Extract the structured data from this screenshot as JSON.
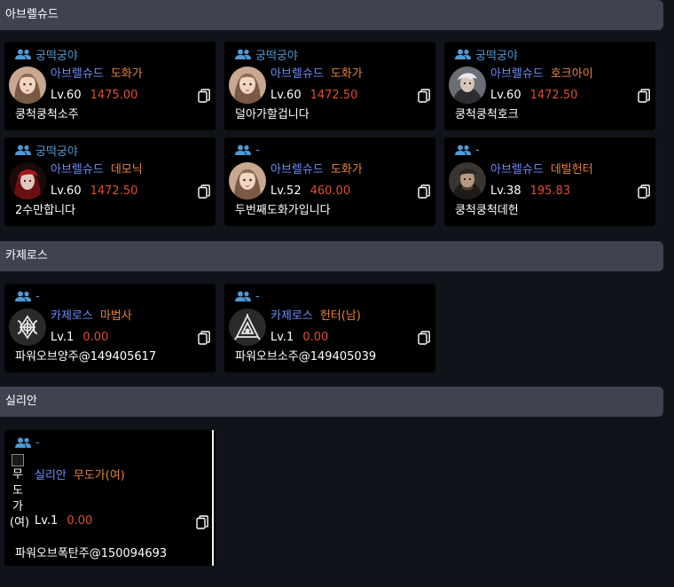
{
  "sections": [
    {
      "title": "아브렐슈드"
    },
    {
      "title": "카제로스"
    },
    {
      "title": "실리안"
    }
  ],
  "cards": [
    {
      "guild": "궁떡궁야",
      "server": "아브렐슈드",
      "class": "도화가",
      "level": "Lv.60",
      "item_level": "1475.00",
      "name": "쿵척쿵척소주",
      "avatar": "artist-female-avatar"
    },
    {
      "guild": "궁떡궁야",
      "server": "아브렐슈드",
      "class": "도화가",
      "level": "Lv.60",
      "item_level": "1472.50",
      "name": "덜아가할겁니다",
      "avatar": "artist-female-avatar"
    },
    {
      "guild": "궁떡궁야",
      "server": "아브렐슈드",
      "class": "호크아이",
      "level": "Lv.60",
      "item_level": "1472.50",
      "name": "쿵척쿵척호크",
      "avatar": "hawkeye-male-avatar"
    },
    {
      "guild": "궁떡궁야",
      "server": "아브렐슈드",
      "class": "데모닉",
      "level": "Lv.60",
      "item_level": "1472.50",
      "name": "2수만합니다",
      "avatar": "demonic-avatar"
    },
    {
      "guild": "-",
      "server": "아브렐슈드",
      "class": "도화가",
      "level": "Lv.52",
      "item_level": "460.00",
      "name": "두번째도화가입니다",
      "avatar": "artist-female-avatar"
    },
    {
      "guild": "-",
      "server": "아브렐슈드",
      "class": "데빌헌터",
      "level": "Lv.38",
      "item_level": "195.83",
      "name": "쿵척쿵척데헌",
      "avatar": "devil-hunter-avatar"
    },
    {
      "guild": "-",
      "server": "카제로스",
      "class": "마법사",
      "level": "Lv.1",
      "item_level": "0.00",
      "name": "파워오브양주@149405617",
      "avatar": "mage-emblem"
    },
    {
      "guild": "-",
      "server": "카제로스",
      "class": "헌터(남)",
      "level": "Lv.1",
      "item_level": "0.00",
      "name": "파워오브소주@149405039",
      "avatar": "hunter-emblem"
    },
    {
      "guild": "-",
      "server": "실리안",
      "class": "무도가(여)",
      "level": "Lv.1",
      "item_level": "0.00",
      "name": "파워오브폭탄주@150094693",
      "avatar": "broken-image",
      "broken_alt": [
        "무",
        "도",
        "가",
        "(여)"
      ]
    }
  ],
  "colors": {
    "background": "#11131a",
    "section_header": "#3f4350",
    "card": "#000000",
    "guild": "#4f9ad6",
    "server": "#6d8dff",
    "class": "#e8823c",
    "item_level": "#dd5030"
  },
  "icons": {
    "guild": "people-icon",
    "copy": "copy-icon"
  }
}
